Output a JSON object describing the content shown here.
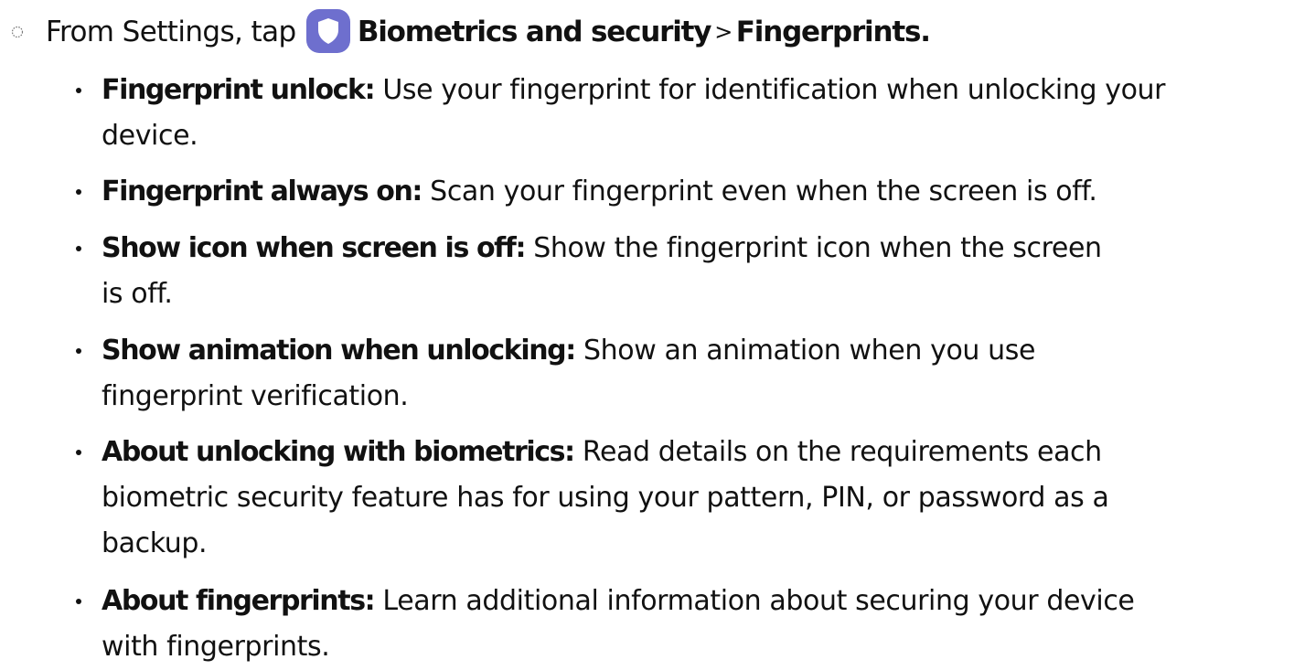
{
  "step": {
    "prefix": "From Settings, tap",
    "app_name": "Biometrics and security",
    "separator": ">",
    "destination": "Fingerprints.",
    "icon": "shield-icon",
    "icon_color": "#6e6fce"
  },
  "options": [
    {
      "term": "Fingerprint unlock:",
      "line1": "Use your fingerprint for identification when unlocking your",
      "line2": "device.",
      "line3": ""
    },
    {
      "term": "Fingerprint always on:",
      "line1": "Scan your fingerprint even when the screen is off.",
      "line2": "",
      "line3": ""
    },
    {
      "term": "Show icon when screen is off:",
      "line1": "Show the fingerprint icon when the screen",
      "line2": "is off.",
      "line3": ""
    },
    {
      "term": "Show animation when unlocking:",
      "line1": "Show an animation when you use",
      "line2": "fingerprint verification.",
      "line3": ""
    },
    {
      "term": "About unlocking with biometrics:",
      "line1": "Read details on the requirements each",
      "line2": "biometric security feature has for using your pattern, PIN, or password as a",
      "line3": "backup."
    },
    {
      "term": "About fingerprints:",
      "line1": "Learn additional information about securing your device",
      "line2": "with fingerprints.",
      "line3": ""
    }
  ]
}
